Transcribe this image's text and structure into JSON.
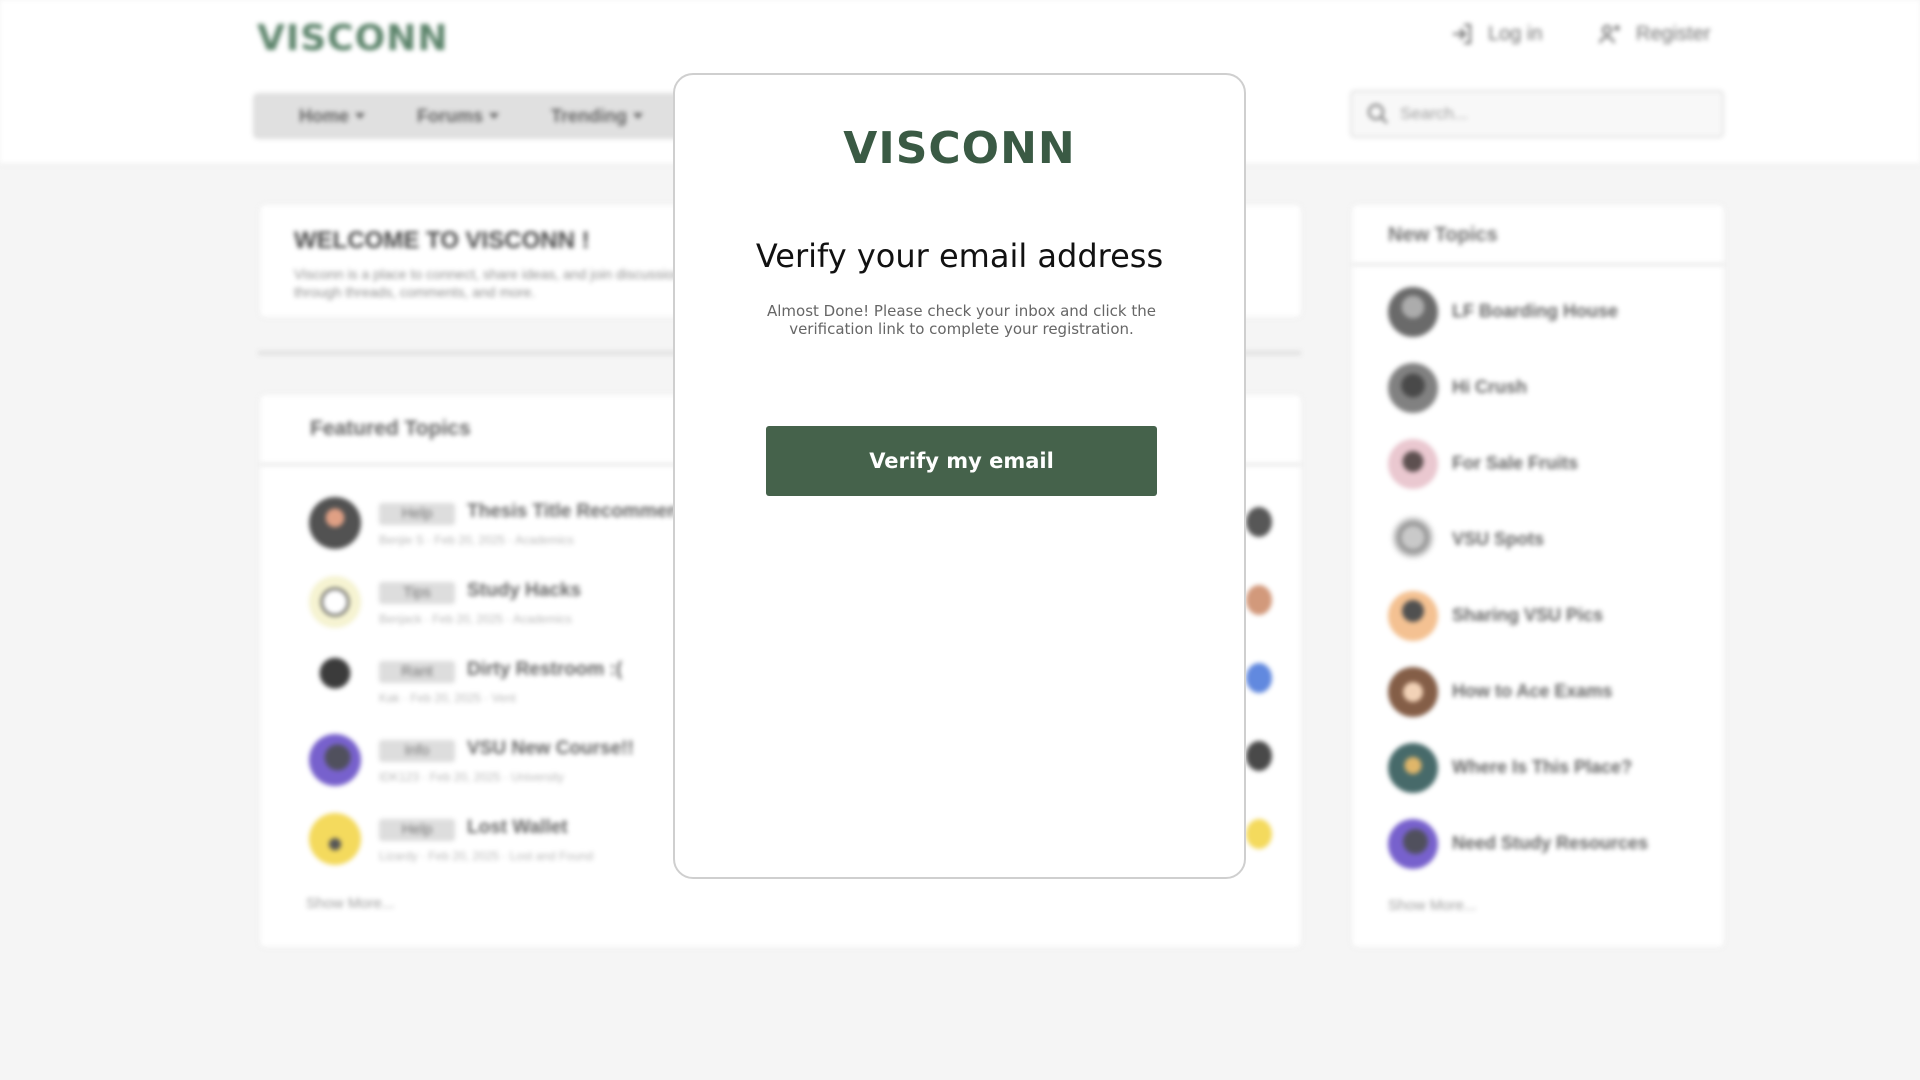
{
  "header": {
    "logo": "VISCONN",
    "login_label": "Log in",
    "register_label": "Register"
  },
  "nav": {
    "items": [
      {
        "label": "Home"
      },
      {
        "label": "Forums"
      },
      {
        "label": "Trending"
      }
    ]
  },
  "search": {
    "placeholder": "Search..."
  },
  "welcome": {
    "title": "WELCOME TO VISCONN !",
    "text": "Visconn is a place to connect, share ideas, and join discussions through threads, comments, and more."
  },
  "featured": {
    "title": "Featured Topics",
    "topics": [
      {
        "tag": "Help",
        "title": "Thesis Title Recommendations",
        "meta": "Benjie S · Feb 20, 2025 · Academics"
      },
      {
        "tag": "Tips",
        "title": "Study Hacks",
        "meta": "Benjack · Feb 20, 2025 · Academics"
      },
      {
        "tag": "Rant",
        "title": "Dirty Restroom :(",
        "meta": "Kak · Feb 20, 2025 · Vent"
      },
      {
        "tag": "Info",
        "title": "VSU New Course!!",
        "meta": "IDK123 · Feb 20, 2025 · University"
      },
      {
        "tag": "Help",
        "title": "Lost Wallet",
        "meta": "Lizardy · Feb 20, 2025 · Lost and Found"
      }
    ],
    "show_more": "Show More..."
  },
  "new_topics": {
    "title": "New Topics",
    "items": [
      {
        "label": "LF Boarding House"
      },
      {
        "label": "Hi Crush"
      },
      {
        "label": "For Sale Fruits"
      },
      {
        "label": "VSU Spots"
      },
      {
        "label": "Sharing VSU Pics"
      },
      {
        "label": "How to Ace Exams"
      },
      {
        "label": "Where Is This Place?"
      },
      {
        "label": "Need Study Resources"
      }
    ],
    "show_more": "Show More..."
  },
  "modal": {
    "logo": "VISCONN",
    "heading": "Verify your email address",
    "text": "Almost Done! Please check your inbox and click the verification link to complete your registration.",
    "button_label": "Verify my email"
  },
  "colors": {
    "brand_green": "#3b6b4d",
    "button_green": "#45624b"
  }
}
